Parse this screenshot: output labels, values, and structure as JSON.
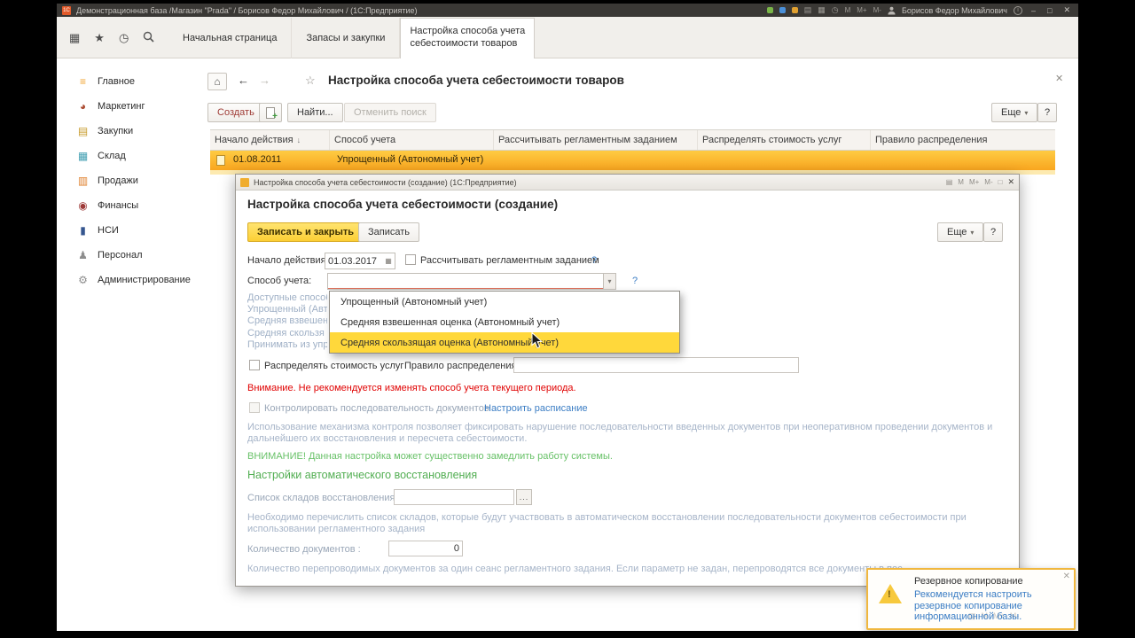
{
  "icons": {
    "logo": "1С",
    "menu_grid": "▦",
    "star": "★",
    "star_outline": "☆",
    "clock": "◷",
    "doc": "▤",
    "home": "⌂",
    "back": "←",
    "forward": "→",
    "close": "✕",
    "minimize": "–",
    "maximize": "□",
    "sort_down": "↓",
    "caret_down": "▾",
    "calendar": "▦",
    "plus": "+",
    "info": "i",
    "exclaim": "!",
    "ellipsis": "..."
  },
  "titlebar": {
    "logo": "1С",
    "title": "Демонстрационная база /Магазин \"Prada\" / Борисов Федор Михайлович / (1С:Предприятие)",
    "memory": [
      "М",
      "М+",
      "М-"
    ],
    "user": "Борисов Федор Михайлович"
  },
  "tabs": [
    {
      "label": "Начальная страница"
    },
    {
      "label": "Запасы и закупки"
    },
    {
      "label": "Настройка способа учета себестоимости товаров"
    }
  ],
  "sidebar": [
    {
      "label": "Главное",
      "glyph": "≡"
    },
    {
      "label": "Маркетинг",
      "glyph": "◕"
    },
    {
      "label": "Закупки",
      "glyph": "▤"
    },
    {
      "label": "Склад",
      "glyph": "▦"
    },
    {
      "label": "Продажи",
      "glyph": "▥"
    },
    {
      "label": "Финансы",
      "glyph": "◉"
    },
    {
      "label": "НСИ",
      "glyph": "▮"
    },
    {
      "label": "Персонал",
      "glyph": "♟"
    },
    {
      "label": "Администрирование",
      "glyph": "⚙"
    }
  ],
  "page": {
    "title": "Настройка способа учета себестоимости товаров",
    "toolbar": {
      "create": "Создать",
      "find": "Найти...",
      "cancel_search": "Отменить поиск",
      "more": "Еще",
      "help": "?"
    },
    "table": {
      "columns": [
        "Начало действия",
        "Способ учета",
        "Рассчитывать регламентным заданием",
        "Распределять стоимость услуг",
        "Правило распределения"
      ],
      "row": {
        "date": "01.08.2011",
        "method": "Упрощенный (Автономный учет)"
      }
    }
  },
  "dialog": {
    "window_title": "Настройка способа учета себестоимости (создание) (1С:Предприятие)",
    "memory": [
      "М",
      "М+",
      "М-"
    ],
    "title": "Настройка способа учета себестоимости (создание)",
    "buttons": {
      "save_close": "Записать и закрыть",
      "save": "Записать",
      "more": "Еще",
      "help": "?"
    },
    "start_date": {
      "label": "Начало действия:",
      "value": "01.03.2017"
    },
    "scheduled": {
      "label": "Рассчитывать регламентным заданием",
      "help": "?"
    },
    "method": {
      "label": "Способ учета:",
      "help": "?"
    },
    "dropdown": [
      "Упрощенный (Автономный учет)",
      "Средняя взвешенная оценка (Автономный учет)",
      "Средняя скользящая оценка (Автономный учет)"
    ],
    "hint_lines": [
      "Доступные способ",
      "Упрощенный (Авт",
      "Средняя взвешен",
      "Средняя скользя",
      "Принимать из упр"
    ],
    "distribute": {
      "label": "Распределять стоимость услуг"
    },
    "rule": {
      "label": "Правило распределения:"
    },
    "warning_red": "Внимание. Не рекомендуется изменять способ учета текущего периода.",
    "control_seq": {
      "label": "Контролировать последовательность документов",
      "link": "Настроить расписание"
    },
    "para1": "Использование механизма контроля позволяет фиксировать нарушение последовательности введенных документов при неоперативном проведении документов и дальнейшего их восстановления и пересчета себестоимости.",
    "warning_green": "ВНИМАНИЕ! Данная настройка может существенно замедлить работу системы.",
    "section_title": "Настройки автоматического восстановления",
    "warehouses": {
      "label": "Список складов восстановления:",
      "browse": "..."
    },
    "para2": "Необходимо перечислить список складов, которые будут участвовать в автоматическом восстановлении последовательности документов себестоимости при использовании регламентного задания",
    "doc_count": {
      "label": "Количество документов :",
      "value": "0"
    },
    "para3": "Количество перепроводимых документов за один сеанс регламентного задания. Если параметр не задан, перепроводятся все документы в пос"
  },
  "notification": {
    "title": "Резервное копирование",
    "text": "Рекомендуется настроить резервное копирование информационной базы.",
    "memory": [
      "М",
      "М+",
      "М-"
    ]
  }
}
